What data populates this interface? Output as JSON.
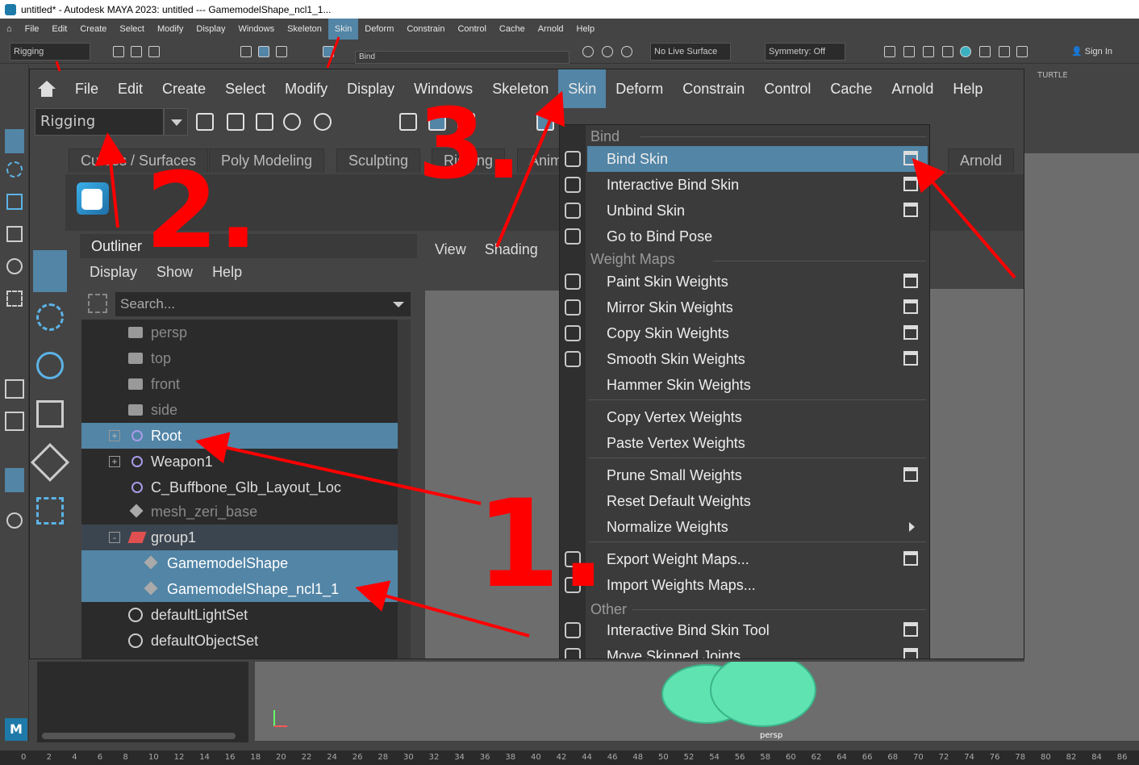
{
  "window": {
    "title": "untitled* - Autodesk MAYA 2023: untitled   ---   GamemodelShape_ncl1_1..."
  },
  "main_menu": [
    "File",
    "Edit",
    "Create",
    "Select",
    "Modify",
    "Display",
    "Windows",
    "Skeleton",
    "Skin",
    "Deform",
    "Constrain",
    "Control",
    "Cache",
    "Arnold",
    "Help"
  ],
  "active_menu": "Skin",
  "back_toolbar": {
    "mode": "Rigging",
    "live_surface": "No Live Surface",
    "symmetry": "Symmetry: Off",
    "sign_in": "Sign In",
    "bind_hint": "Bind",
    "turtle_tab": "TURTLE"
  },
  "zoom": {
    "mode": "Rigging",
    "shelf_tabs": [
      "Curves / Surfaces",
      "Poly Modeling",
      "Sculpting",
      "Rigging",
      "Animation",
      "Arnold"
    ]
  },
  "outliner": {
    "title": "Outliner",
    "menu": [
      "Display",
      "Show",
      "Help"
    ],
    "search_placeholder": "Search...",
    "rows": [
      {
        "label": "persp",
        "icon": "camera-icon",
        "state": "dim"
      },
      {
        "label": "top",
        "icon": "camera-icon",
        "state": "dim"
      },
      {
        "label": "front",
        "icon": "camera-icon",
        "state": "dim"
      },
      {
        "label": "side",
        "icon": "camera-icon",
        "state": "dim"
      },
      {
        "label": "Root",
        "icon": "joint-icon",
        "state": "selected",
        "expand": "+"
      },
      {
        "label": "Weapon1",
        "icon": "joint-icon",
        "state": "normal",
        "expand": "+"
      },
      {
        "label": "C_Buffbone_Glb_Layout_Loc",
        "icon": "joint-icon",
        "state": "normal"
      },
      {
        "label": "mesh_zeri_base",
        "icon": "mesh-icon",
        "state": "dim"
      },
      {
        "label": "group1",
        "icon": "group-icon",
        "state": "group",
        "expand": "-"
      },
      {
        "label": "GamemodelShape",
        "icon": "mesh-icon",
        "state": "selected"
      },
      {
        "label": "GamemodelShape_ncl1_1",
        "icon": "mesh-icon",
        "state": "selected"
      },
      {
        "label": "defaultLightSet",
        "icon": "set-icon",
        "state": "normal"
      },
      {
        "label": "defaultObjectSet",
        "icon": "set-icon",
        "state": "normal"
      }
    ]
  },
  "viewport": {
    "menu": [
      "View",
      "Shading"
    ],
    "camera_label": "persp"
  },
  "skin_menu": {
    "sections": [
      "Bind",
      "Weight Maps",
      "Other"
    ],
    "items": [
      "Bind Skin",
      "Interactive Bind Skin",
      "Unbind Skin",
      "Go to Bind Pose",
      "Paint Skin Weights",
      "Mirror Skin Weights",
      "Copy Skin Weights",
      "Smooth Skin Weights",
      "Hammer Skin Weights",
      "Copy Vertex Weights",
      "Paste Vertex Weights",
      "Prune Small Weights",
      "Reset Default Weights",
      "Normalize Weights",
      "Export Weight Maps...",
      "Import Weights Maps...",
      "Interactive Bind Skin Tool",
      "Move Skinned Joints"
    ],
    "highlighted": "Bind Skin"
  },
  "annotations": [
    "1.",
    "2.",
    "3."
  ],
  "timeline": [
    "0",
    "2",
    "4",
    "6",
    "8",
    "10",
    "12",
    "14",
    "16",
    "18",
    "20",
    "22",
    "24",
    "26",
    "28",
    "30",
    "32",
    "34",
    "36",
    "38",
    "40",
    "42",
    "44",
    "46",
    "48",
    "50",
    "52",
    "54",
    "56",
    "58",
    "60",
    "62",
    "64",
    "66",
    "68",
    "70",
    "72",
    "74",
    "76",
    "78",
    "80",
    "82",
    "84",
    "86"
  ],
  "colors": {
    "highlight": "#5285a6",
    "annotation": "#ff0000",
    "mesh": "#5fe3b0"
  }
}
